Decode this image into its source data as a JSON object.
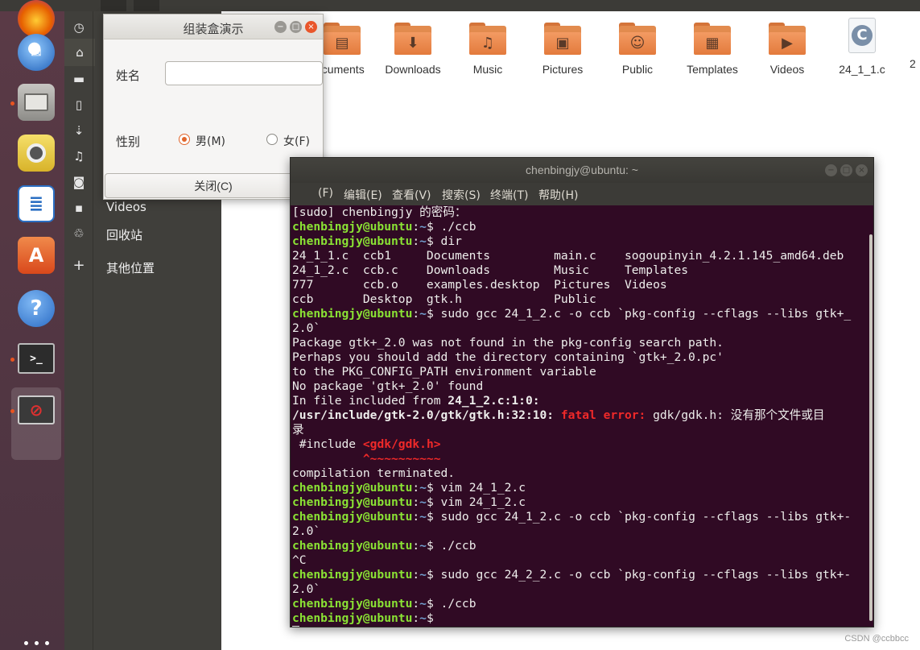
{
  "dock": {
    "items": [
      {
        "name": "firefox-icon",
        "color": "#e66000"
      },
      {
        "name": "thunderbird-icon",
        "color": "#2a6fc9"
      },
      {
        "name": "files-icon",
        "color": "#8a8a86"
      },
      {
        "name": "rhythmbox-icon",
        "color": "#f1cf3a"
      },
      {
        "name": "libreoffice-writer-icon",
        "color": "#2b6fc3"
      },
      {
        "name": "software-center-icon",
        "color": "#e95420"
      },
      {
        "name": "help-icon",
        "color": "#3c84d6"
      },
      {
        "name": "terminal-icon",
        "color": "#2c2c2c"
      },
      {
        "name": "running-app-icon",
        "color": "#3a3a3a"
      }
    ]
  },
  "files": {
    "sidebar": {
      "videos_label": "Videos",
      "trash_label": "回收站",
      "other_locations_label": "其他位置"
    },
    "folders": [
      {
        "label": "ocuments",
        "glyph": "▤"
      },
      {
        "label": "Downloads",
        "glyph": "⬇"
      },
      {
        "label": "Music",
        "glyph": "♫"
      },
      {
        "label": "Pictures",
        "glyph": "▣"
      },
      {
        "label": "Public",
        "glyph": "☺"
      },
      {
        "label": "Templates",
        "glyph": "▦"
      },
      {
        "label": "Videos",
        "glyph": "▶"
      }
    ],
    "c_file": {
      "label": "24_1_1.c",
      "glyph": "C"
    },
    "cut_label": "2"
  },
  "dialog": {
    "title": "组装盒演示",
    "name_label": "姓名",
    "name_value": "",
    "gender_label": "性别",
    "male_label": "男(M)",
    "female_label": "女(F)",
    "gender_selected": "male",
    "close_label": "关闭(C)"
  },
  "terminal": {
    "title": "chenbingjy@ubuntu: ~",
    "menu": [
      "(F)",
      "编辑(E)",
      "查看(V)",
      "搜索(S)",
      "终端(T)",
      "帮助(H)"
    ],
    "prompt_user": "chenbingjy@ubuntu",
    "prompt_path": "~",
    "lines": [
      {
        "t": "plain",
        "text": "[sudo] chenbingjy 的密码："
      },
      {
        "t": "prompt",
        "text": "./ccb"
      },
      {
        "t": "prompt",
        "text": "dir"
      },
      {
        "t": "plain",
        "text": "24_1_1.c  ccb1     Documents         main.c    sogoupinyin_4.2.1.145_amd64.deb"
      },
      {
        "t": "plain",
        "text": "24_1_2.c  ccb.c    Downloads         Music     Templates"
      },
      {
        "t": "plain",
        "text": "777       ccb.o    examples.desktop  Pictures  Videos"
      },
      {
        "t": "plain",
        "text": "ccb       Desktop  gtk.h             Public"
      },
      {
        "t": "prompt",
        "text": "sudo gcc 24_1_2.c -o ccb `pkg-config --cflags --libs gtk+_"
      },
      {
        "t": "plain",
        "text": "2.0`"
      },
      {
        "t": "plain",
        "text": "Package gtk+_2.0 was not found in the pkg-config search path."
      },
      {
        "t": "plain",
        "text": "Perhaps you should add the directory containing `gtk+_2.0.pc'"
      },
      {
        "t": "plain",
        "text": "to the PKG_CONFIG_PATH environment variable"
      },
      {
        "t": "plain",
        "text": "No package 'gtk+_2.0' found"
      },
      {
        "t": "include",
        "a": "In file included from ",
        "b": "24_1_2.c:1:0:"
      },
      {
        "t": "error",
        "path": "/usr/include/gtk-2.0/gtk/gtk.h:32:10:",
        "kind": "fatal error:",
        "msg": " gdk/gdk.h: 没有那个文件或目"
      },
      {
        "t": "plain",
        "text": "录"
      },
      {
        "t": "incl",
        "a": " #include ",
        "b": "<gdk/gdk.h>"
      },
      {
        "t": "caret",
        "text": "          ^~~~~~~~~~~"
      },
      {
        "t": "plain",
        "text": "compilation terminated."
      },
      {
        "t": "prompt",
        "text": "vim 24_1_2.c"
      },
      {
        "t": "prompt",
        "text": "vim 24_1_2.c"
      },
      {
        "t": "prompt",
        "text": "sudo gcc 24_1_2.c -o ccb `pkg-config --cflags --libs gtk+-"
      },
      {
        "t": "plain",
        "text": "2.0`"
      },
      {
        "t": "prompt",
        "text": "./ccb"
      },
      {
        "t": "plain",
        "text": "^C"
      },
      {
        "t": "prompt",
        "text": "sudo gcc 24_2_2.c -o ccb `pkg-config --cflags --libs gtk+-"
      },
      {
        "t": "plain",
        "text": "2.0`"
      },
      {
        "t": "prompt",
        "text": "./ccb"
      },
      {
        "t": "cursor",
        "text": ""
      }
    ]
  },
  "watermark": "CSDN @ccbbcc",
  "colors": {
    "prompt_green": "#8ae234",
    "path_blue": "#729fcf",
    "error_red": "#ef2929",
    "terminal_bg": "#300a24",
    "accent": "#e95420"
  }
}
